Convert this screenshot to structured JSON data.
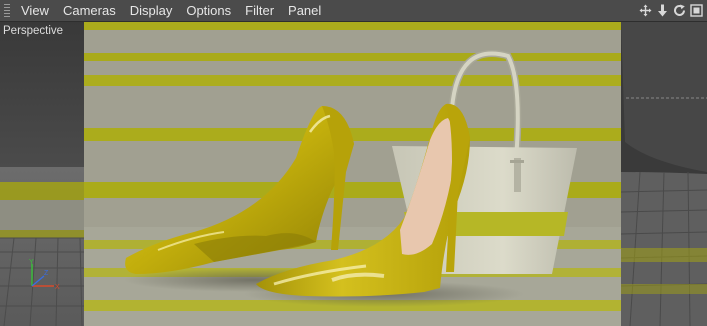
{
  "menubar": {
    "items": [
      "View",
      "Cameras",
      "Display",
      "Options",
      "Filter",
      "Panel"
    ]
  },
  "nav_icons": [
    "move-view-icon",
    "dolly-view-icon",
    "rotate-view-icon",
    "maximize-view-icon"
  ],
  "viewport": {
    "label": "Perspective"
  },
  "colors": {
    "menubar_bg": "#4b4b4b",
    "viewport_bg": "#3a3a3a",
    "stripe_yellow": "#b8b81c",
    "stripe_gray": "#a5a494",
    "shoe_yellow": "#c9b60f",
    "axis_x": "#d84a2a",
    "axis_y": "#38c238",
    "axis_z": "#3a6de0"
  }
}
